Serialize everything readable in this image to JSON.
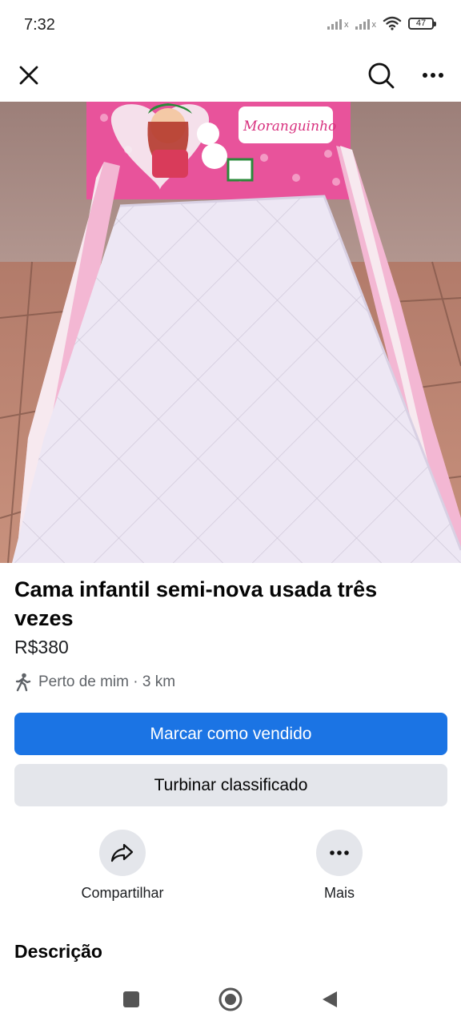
{
  "status_bar": {
    "time": "7:32",
    "battery": "47",
    "icons": [
      "signal-icon",
      "signal-icon",
      "wifi-icon",
      "battery-icon"
    ]
  },
  "top_nav": {
    "icons": [
      "close-icon",
      "search-icon",
      "more-icon"
    ]
  },
  "photo": {
    "headboard_text": "Moranguinho",
    "pager_count": 2,
    "pager_active_index": 0
  },
  "listing": {
    "title": "Cama infantil semi-nova usada três vezes",
    "price": "R$380",
    "location": "Perto de mim · 3 km"
  },
  "buttons": {
    "mark_sold": "Marcar como vendido",
    "boost": "Turbinar classificado"
  },
  "actions": {
    "share": "Compartilhar",
    "more": "Mais"
  },
  "description": {
    "heading": "Descrição"
  },
  "colors": {
    "primary": "#1b74e4",
    "secondary_bg": "#e4e6eb",
    "headboard_pink": "#e8539b"
  }
}
